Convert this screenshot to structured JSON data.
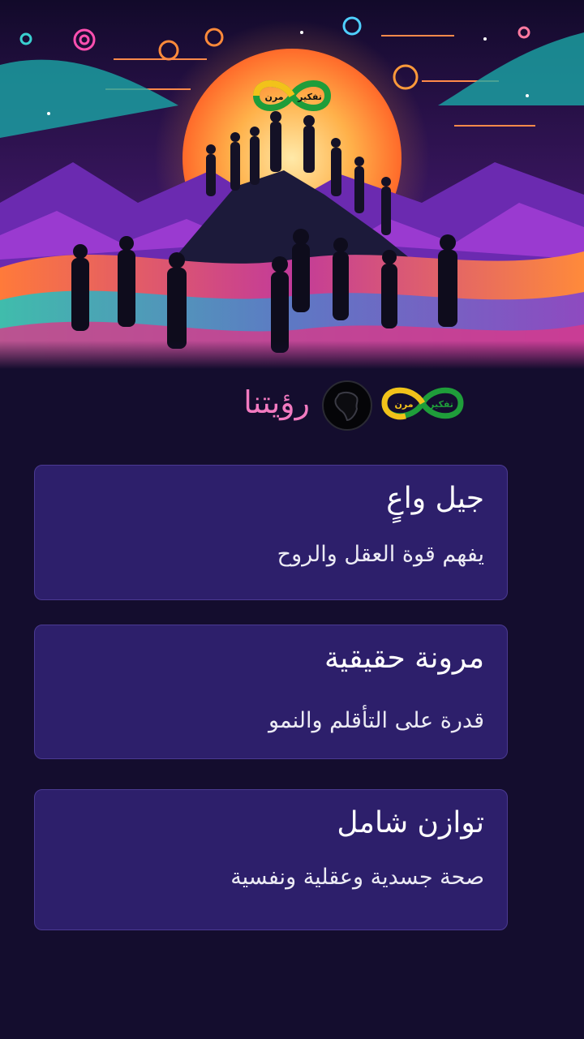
{
  "header": {
    "title": "رؤيتنا",
    "brand_logo": {
      "top_text": "تفكير",
      "bottom_text": "مرن",
      "icon": "infinity-logo-icon"
    },
    "globe_icon": "africa-globe-icon"
  },
  "hero": {
    "logo": {
      "top_text": "تفكير",
      "bottom_text": "مرن"
    },
    "illustration": "people-silhouettes-mountain-sunset"
  },
  "cards": [
    {
      "title": "جيل واعٍ",
      "description": "يفهم قوة العقل والروح"
    },
    {
      "title": "مرونة حقيقية",
      "description": "قدرة على التأقلم والنمو"
    },
    {
      "title": "توازن شامل",
      "description": "صحة جسدية وعقلية ونفسية"
    }
  ],
  "colors": {
    "background": "#140d2e",
    "card": "#2d1f6b",
    "title_accent": "#f27ac0",
    "logo_green": "#1f9d3a",
    "logo_yellow": "#f2c21a"
  }
}
